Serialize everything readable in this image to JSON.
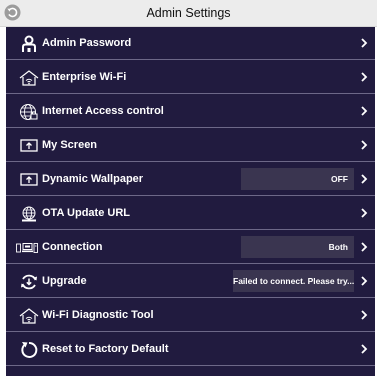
{
  "header": {
    "title": "Admin Settings"
  },
  "rows": [
    {
      "label": "Admin Password",
      "icon": "person-lock-icon"
    },
    {
      "label": "Enterprise Wi-Fi",
      "icon": "wifi-house-icon"
    },
    {
      "label": "Internet Access control",
      "icon": "globe-lock-icon"
    },
    {
      "label": "My Screen",
      "icon": "screen-upload-icon"
    },
    {
      "label": "Dynamic Wallpaper",
      "icon": "screen-upload-icon",
      "value": "OFF"
    },
    {
      "label": "OTA Update URL",
      "icon": "globe-icon"
    },
    {
      "label": "Connection",
      "icon": "devices-icon",
      "value": "Both"
    },
    {
      "label": "Upgrade",
      "icon": "refresh-download-icon",
      "value": "Failed to connect. Please try..."
    },
    {
      "label": "Wi-Fi Diagnostic Tool",
      "icon": "wifi-house-icon"
    },
    {
      "label": "Reset to Factory Default",
      "icon": "reset-icon"
    }
  ]
}
